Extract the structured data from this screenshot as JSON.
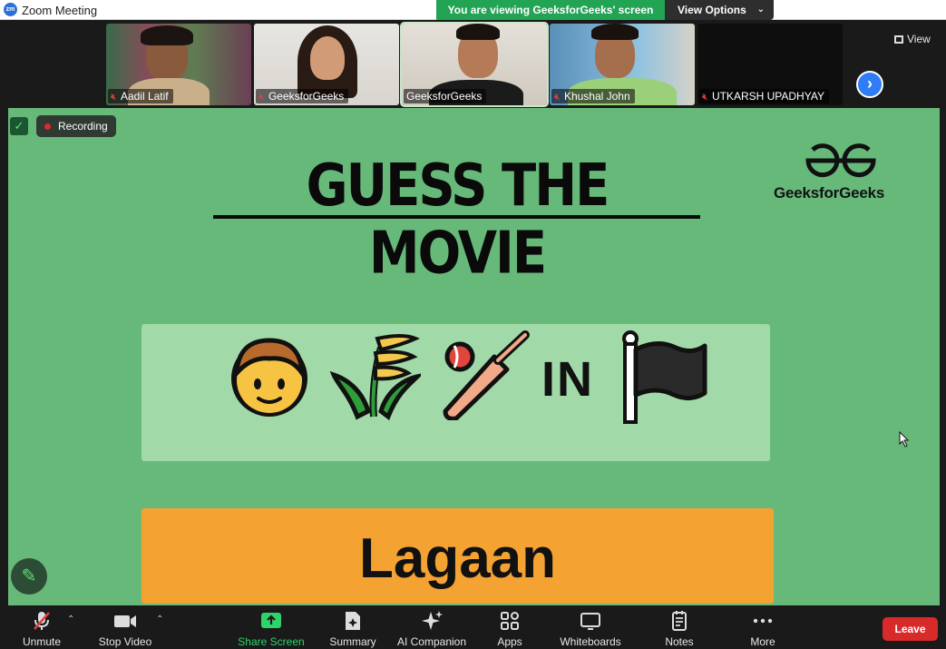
{
  "window": {
    "app_icon": "zm",
    "title": "Zoom Meeting"
  },
  "share_banner": {
    "text": "You are viewing GeeksforGeeks' screen",
    "view_options": "View Options"
  },
  "participants": [
    {
      "name": "Aadil Latif",
      "muted": true
    },
    {
      "name": "GeeksforGeeks",
      "muted": true
    },
    {
      "name": "GeeksforGeeks",
      "muted": false,
      "active_speaker": true
    },
    {
      "name": "Khushal John",
      "muted": true
    },
    {
      "name": "UTKARSH UPADHYAY",
      "muted": true
    }
  ],
  "strip_controls": {
    "view_label": "View"
  },
  "shared_screen": {
    "recording_label": "Recording",
    "headline": "GUESS THE MOVIE",
    "brand": "GeeksforGeeks",
    "clue_emojis": [
      "boy-face-icon",
      "wheat-crop-icon",
      "cricket-bat-ball-icon"
    ],
    "clue_word": "IN",
    "clue_flag": "black-flag-icon",
    "answer": "Lagaan"
  },
  "toolbar": {
    "unmute": "Unmute",
    "stop_video": "Stop Video",
    "share_screen": "Share Screen",
    "summary": "Summary",
    "ai_companion": "AI Companion",
    "apps": "Apps",
    "whiteboards": "Whiteboards",
    "notes": "Notes",
    "more": "More",
    "leave": "Leave"
  },
  "colors": {
    "share_bg": "#67b97a",
    "clue_bg": "#a2d9a8",
    "answer_bg": "#f4a232",
    "leave": "#d92a2a",
    "banner": "#23a354"
  }
}
